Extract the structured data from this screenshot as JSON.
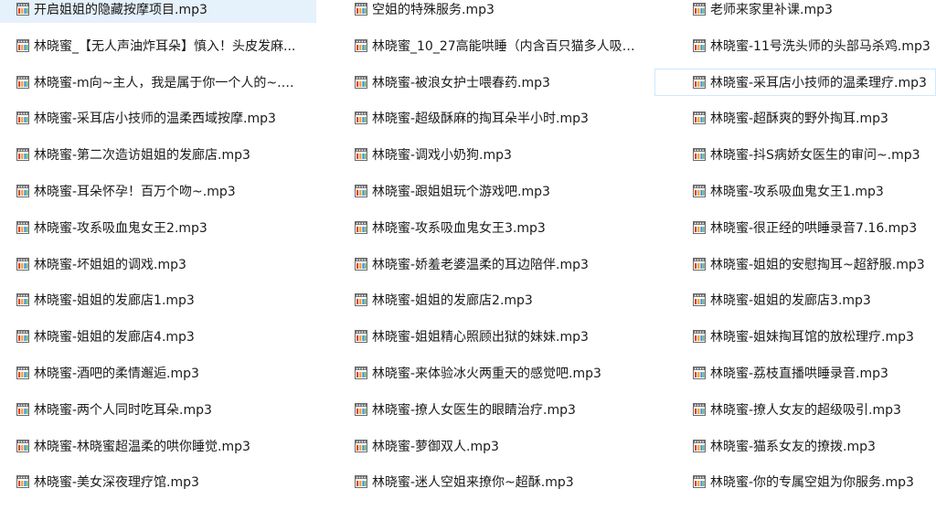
{
  "colors": {
    "selected_bg": "#e5f1fb",
    "hover_border": "#cde8ff",
    "icon_film": "#6a6a6a",
    "icon_band": "#d9452b"
  },
  "icon_name": "audio-file-icon",
  "selected_index": 0,
  "hovered_index": 8,
  "files": [
    "开启姐姐的隐藏按摩项目.mp3",
    "空姐的特殊服务.mp3",
    "老师来家里补课.mp3",
    "林晓蜜_【无人声油炸耳朵】慎入！头皮发麻...",
    "林晓蜜_10_27高能哄睡（内含百只猫多人吸脑...",
    "林晓蜜-11号洗头师的头部马杀鸡.mp3",
    "林晓蜜-m向~主人，我是属于你一个人的~.m...",
    "林晓蜜-被浪女护士喂春药.mp3",
    "林晓蜜-采耳店小技师的温柔理疗.mp3",
    "林晓蜜-采耳店小技师的温柔西域按摩.mp3",
    "林晓蜜-超级酥麻的掏耳朵半小时.mp3",
    "林晓蜜-超酥爽的野外掏耳.mp3",
    "林晓蜜-第二次造访姐姐的发廊店.mp3",
    "林晓蜜-调戏小奶狗.mp3",
    "林晓蜜-抖S病娇女医生的审问~.mp3",
    "林晓蜜-耳朵怀孕！百万个吻~.mp3",
    "林晓蜜-跟姐姐玩个游戏吧.mp3",
    "林晓蜜-攻系吸血鬼女王1.mp3",
    "林晓蜜-攻系吸血鬼女王2.mp3",
    "林晓蜜-攻系吸血鬼女王3.mp3",
    "林晓蜜-很正经的哄睡录音7.16.mp3",
    "林晓蜜-坏姐姐的调戏.mp3",
    "林晓蜜-娇羞老婆温柔的耳边陪伴.mp3",
    "林晓蜜-姐姐的安慰掏耳~超舒服.mp3",
    "林晓蜜-姐姐的发廊店1.mp3",
    "林晓蜜-姐姐的发廊店2.mp3",
    "林晓蜜-姐姐的发廊店3.mp3",
    "林晓蜜-姐姐的发廊店4.mp3",
    "林晓蜜-姐姐精心照顾出狱的妹妹.mp3",
    "林晓蜜-姐妹掏耳馆的放松理疗.mp3",
    "林晓蜜-酒吧的柔情邂逅.mp3",
    "林晓蜜-来体验冰火两重天的感觉吧.mp3",
    "林晓蜜-荔枝直播哄睡录音.mp3",
    "林晓蜜-两个人同时吃耳朵.mp3",
    "林晓蜜-撩人女医生的眼睛治疗.mp3",
    "林晓蜜-撩人女友的超级吸引.mp3",
    "林晓蜜-林晓蜜超温柔的哄你睡觉.mp3",
    "林晓蜜-萝御双人.mp3",
    "林晓蜜-猫系女友的撩拨.mp3",
    "林晓蜜-美女深夜理疗馆.mp3",
    "林晓蜜-迷人空姐来撩你~超酥.mp3",
    "林晓蜜-你的专属空姐为你服务.mp3"
  ]
}
